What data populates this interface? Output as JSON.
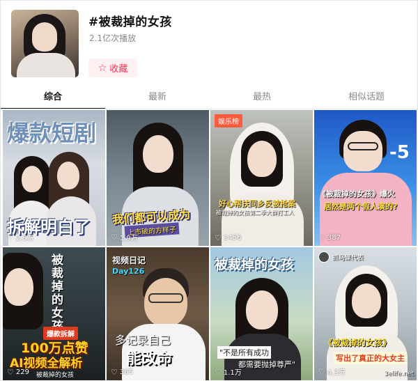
{
  "header": {
    "title": "#被裁掉的女孩",
    "play_count": "2.1亿次播放",
    "favorite_label": "收藏",
    "favorite_icon": "star-outline-icon",
    "accent_color": "#fe2c55"
  },
  "tabs": [
    {
      "label": "综合",
      "active": true
    },
    {
      "label": "最新",
      "active": false
    },
    {
      "label": "最热",
      "active": false
    },
    {
      "label": "相似话题",
      "active": false
    }
  ],
  "videos": [
    {
      "caption_top": "爆款短剧",
      "caption_bottom": "拆解明白了",
      "likes": "2.5万"
    },
    {
      "caption_top": "",
      "caption_bottom": "我们都可以成为",
      "caption_sub": "上市破的方样子",
      "likes": "1.9万"
    },
    {
      "badge": "娱乐榜",
      "caption_mid": "好心帮扶同乡反被抢案",
      "caption_sub": "被裁掉的女孩第二季大群打工人",
      "likes": "1456"
    },
    {
      "caption_top": "-5",
      "caption_mid": "《被裁掉的女孩》爆火",
      "caption_sub": "居然是两个假人演的?",
      "likes": "387"
    },
    {
      "caption_vertical": "被裁掉的女孩",
      "tag": "爆款拆解",
      "caption_big": "100万点赞",
      "caption_big2": "AI视频全解析",
      "caption_sub": "被裁掉的女孩",
      "likes": "229"
    },
    {
      "caption_top": "视频日记",
      "caption_top2": "Day126",
      "caption_mid": "多记录自己",
      "caption_big": "能改命",
      "likes": "365"
    },
    {
      "caption_top": "被裁掉的女孩",
      "caption_mid": "\"不是所有成功",
      "caption_mid2": "都需要抛掉尊严\"",
      "likes": "1.1万"
    },
    {
      "author": "抓马课代表",
      "caption_mid": "《被裁掉的女孩》",
      "caption_sub": "写出了真正的大女主",
      "likes": "4.3万"
    }
  ],
  "watermark": "3elife.net"
}
